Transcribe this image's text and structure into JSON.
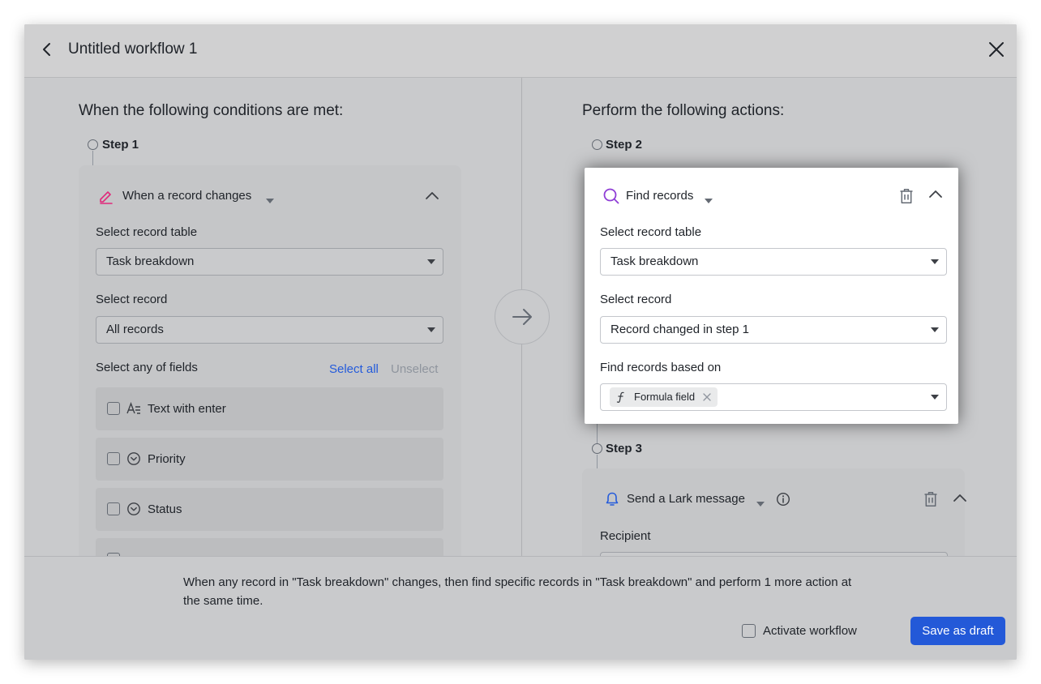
{
  "header": {
    "title": "Untitled workflow 1"
  },
  "left": {
    "section_title": "When the following conditions are met:",
    "step_label": "Step 1",
    "card": {
      "title": "When a record changes",
      "table_label": "Select record table",
      "table_value": "Task breakdown",
      "record_label": "Select record",
      "record_value": "All records",
      "fields_label": "Select any of fields",
      "select_all": "Select all",
      "unselect": "Unselect",
      "fields": [
        {
          "name": "Text with enter",
          "icon": "text-field-icon"
        },
        {
          "name": "Priority",
          "icon": "single-select-icon"
        },
        {
          "name": "Status",
          "icon": "single-select-icon"
        }
      ]
    }
  },
  "right": {
    "section_title": "Perform the following actions:",
    "step2": {
      "label": "Step 2",
      "title": "Find records",
      "table_label": "Select record table",
      "table_value": "Task breakdown",
      "record_label": "Select record",
      "record_value": "Record changed in step 1",
      "based_label": "Find records based on",
      "tag": "Formula field"
    },
    "step3": {
      "label": "Step 3",
      "title": "Send a Lark message",
      "recipient_label": "Recipient"
    }
  },
  "footer": {
    "summary": "When any record in \"Task breakdown\" changes, then find specific records in \"Task breakdown\" and perform 1 more action at the same time.",
    "activate_label": "Activate workflow",
    "save_label": "Save as draft"
  },
  "colors": {
    "accent": "#245bdb",
    "button": "#2359d8",
    "trigger_icon": "#e0297a",
    "find_icon": "#8f3ed6",
    "lark_icon": "#245bdb"
  }
}
